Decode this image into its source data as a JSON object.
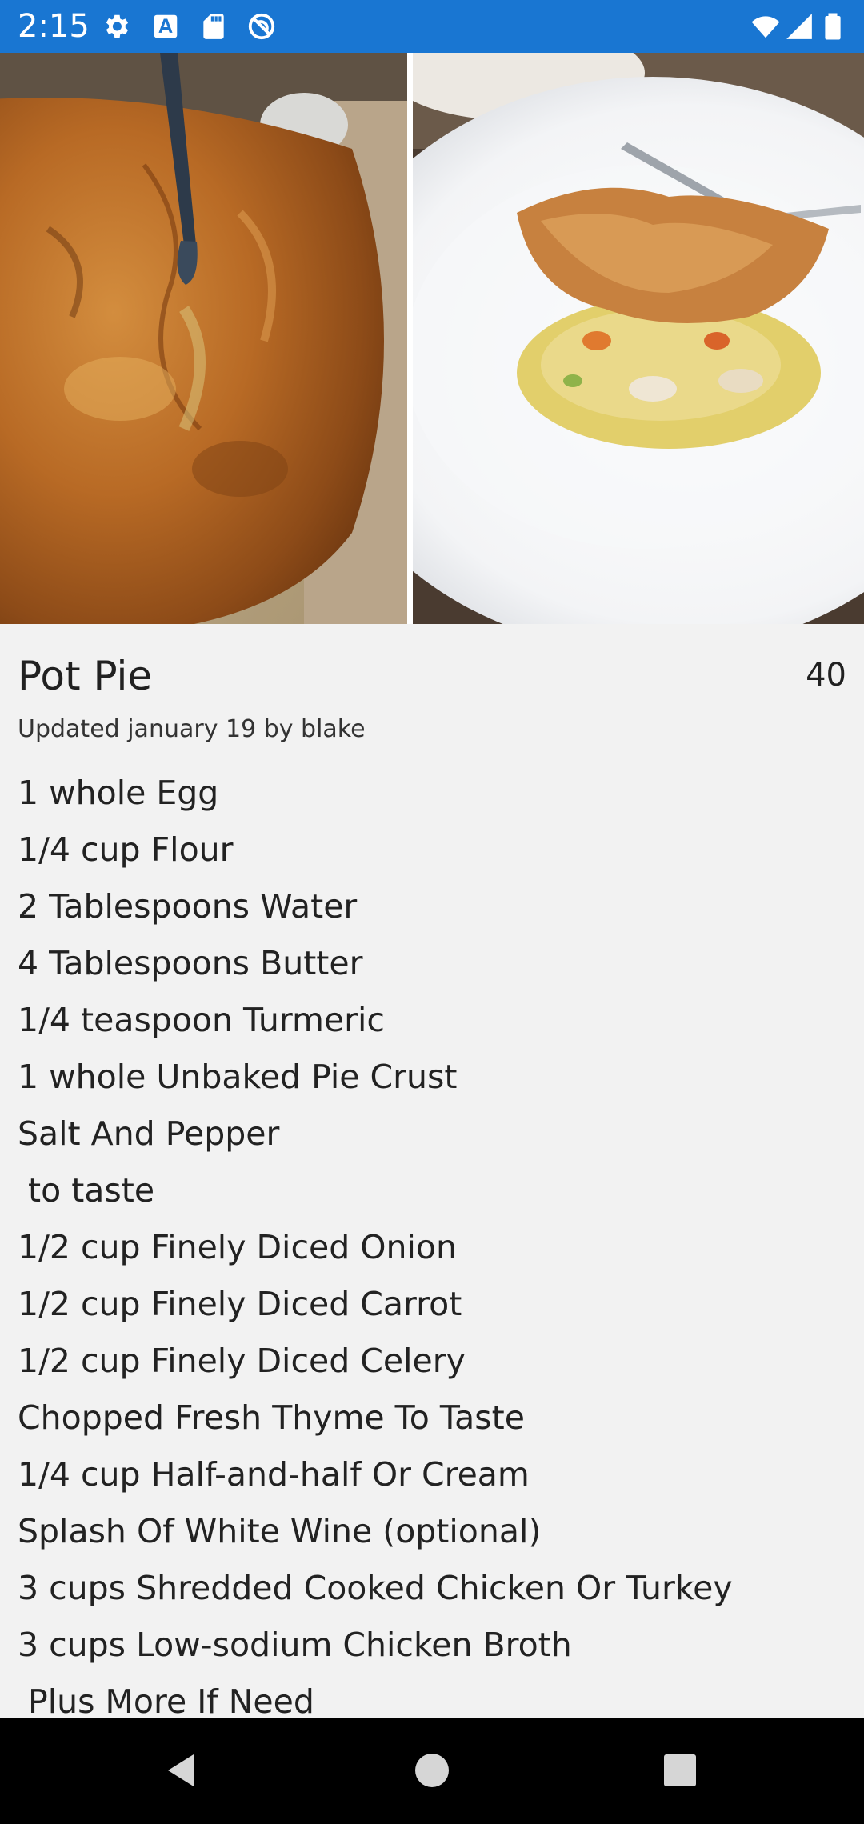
{
  "status_bar": {
    "time": "2:15",
    "icons": [
      "settings-icon",
      "font-download-icon",
      "sd-card-icon",
      "do-not-disturb-icon",
      "wifi-icon",
      "cellular-signal-icon",
      "battery-icon"
    ],
    "background": "#1976d2"
  },
  "hero": {
    "left_image": "pot-pie-whole-photo",
    "right_image": "pot-pie-plated-photo"
  },
  "recipe": {
    "title": "Pot Pie",
    "rating": "40",
    "updated": "Updated january 19 by blake",
    "ingredients": [
      "1 whole Egg",
      "1/4 cup Flour",
      "2 Tablespoons Water",
      "4 Tablespoons Butter",
      "1/4 teaspoon Turmeric",
      "1 whole Unbaked Pie Crust",
      "Salt And Pepper",
      " to taste",
      "1/2 cup Finely Diced Onion",
      "1/2 cup Finely Diced Carrot",
      "1/2 cup Finely Diced Celery",
      "Chopped Fresh Thyme To Taste",
      "1/4 cup Half-and-half Or Cream",
      "Splash Of White Wine (optional)",
      "3 cups Shredded Cooked Chicken Or Turkey",
      "3 cups Low-sodium Chicken Broth",
      " Plus More If Need"
    ]
  },
  "nav_bar": {
    "buttons": [
      "back-icon",
      "home-icon",
      "recents-icon"
    ]
  }
}
